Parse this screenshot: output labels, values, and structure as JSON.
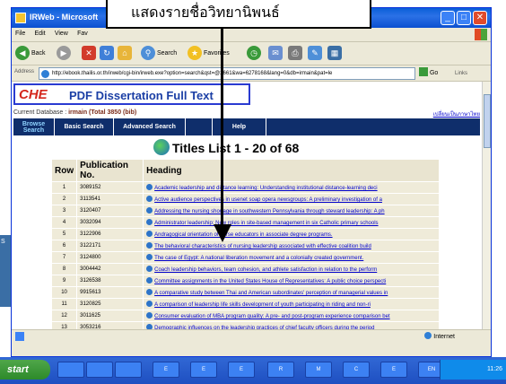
{
  "annotation": {
    "text": "แสดงรายชื่อวิทยานิพนธ์"
  },
  "desktop": {
    "side_label": "S"
  },
  "window": {
    "title": "IRWeb - Microsoft",
    "min": "_",
    "max": "□",
    "close": "✕"
  },
  "menu": {
    "items": [
      "File",
      "Edit",
      "View",
      "Fav"
    ]
  },
  "toolbar": {
    "back": "Back",
    "search": "Search",
    "favorites": "Favorites"
  },
  "address": {
    "label": "Address",
    "url": "http://ebook.thailis.or.th/irweb/cgi-bin/irweb.exe?option=search&qst=@2661&wa=6278168&lang=0&db=irmain&pat=le",
    "go": "Go",
    "links": "Links"
  },
  "page": {
    "logo_che": "CHE",
    "logo_text": "PDF Dissertation Full Text",
    "db_label": "Current Database : ",
    "db_value": "irmain (Total 3850 (bib)",
    "lang_text": "เปลี่ยนเป็นภาษาไทย",
    "nav": [
      "Browse Search",
      "Basic Search",
      "Advanced Search",
      "",
      "Help"
    ],
    "list_title": "Titles List 1 - 20 of 68",
    "columns": [
      "Row",
      "Publication No.",
      "Heading"
    ],
    "rows": [
      {
        "row": "1",
        "pub": "3089152",
        "heading": "Academic leadership and distance learning: Understanding institutional distance-learning deci"
      },
      {
        "row": "2",
        "pub": "3113541",
        "heading": "Active audience perspectives in usenet soap opera newsgroups: A preliminary investigation of a"
      },
      {
        "row": "3",
        "pub": "3120407",
        "heading": "Addressing the nursing shortage in southwestern Pennsylvania through steward leadership: A ph"
      },
      {
        "row": "4",
        "pub": "3032094",
        "heading": "Administrator leadership: New roles in site-based management in six Catholic primary schools"
      },
      {
        "row": "5",
        "pub": "3122906",
        "heading": "Andragogical orientation of nurse educators in associate degree programs."
      },
      {
        "row": "6",
        "pub": "3122171",
        "heading": "The behavioral characteristics of nursing leadership associated with effective coalition build"
      },
      {
        "row": "7",
        "pub": "3124800",
        "heading": "The case of Egypt: A national liberation movement and a colonially created government."
      },
      {
        "row": "8",
        "pub": "3004442",
        "heading": "Coach leadership behaviors, team cohesion, and athlete satisfaction in relation to the perform"
      },
      {
        "row": "9",
        "pub": "3126538",
        "heading": "Committee assignments in the United States House of Representatives: A public choice perspecti"
      },
      {
        "row": "10",
        "pub": "9915613",
        "heading": "A comparative study between Thai and American subordinates' perception of managerial values in"
      },
      {
        "row": "11",
        "pub": "3120825",
        "heading": "A comparison of leadership life skills development of youth participating in riding and non-ri"
      },
      {
        "row": "12",
        "pub": "3011625",
        "heading": "Consumer evaluation of MBA program quality: A pre- and post-program experience comparison bet"
      },
      {
        "row": "13",
        "pub": "3053216",
        "heading": "Demographic influences on the leadership practices of chief faculty officers during the period"
      }
    ]
  },
  "status": {
    "zone": "Internet"
  },
  "taskbar": {
    "start": "start",
    "tasks": [
      "",
      "",
      "",
      "E",
      "E",
      "E",
      "R",
      "M",
      "C",
      "E",
      "EN"
    ],
    "clock": "11:26"
  }
}
